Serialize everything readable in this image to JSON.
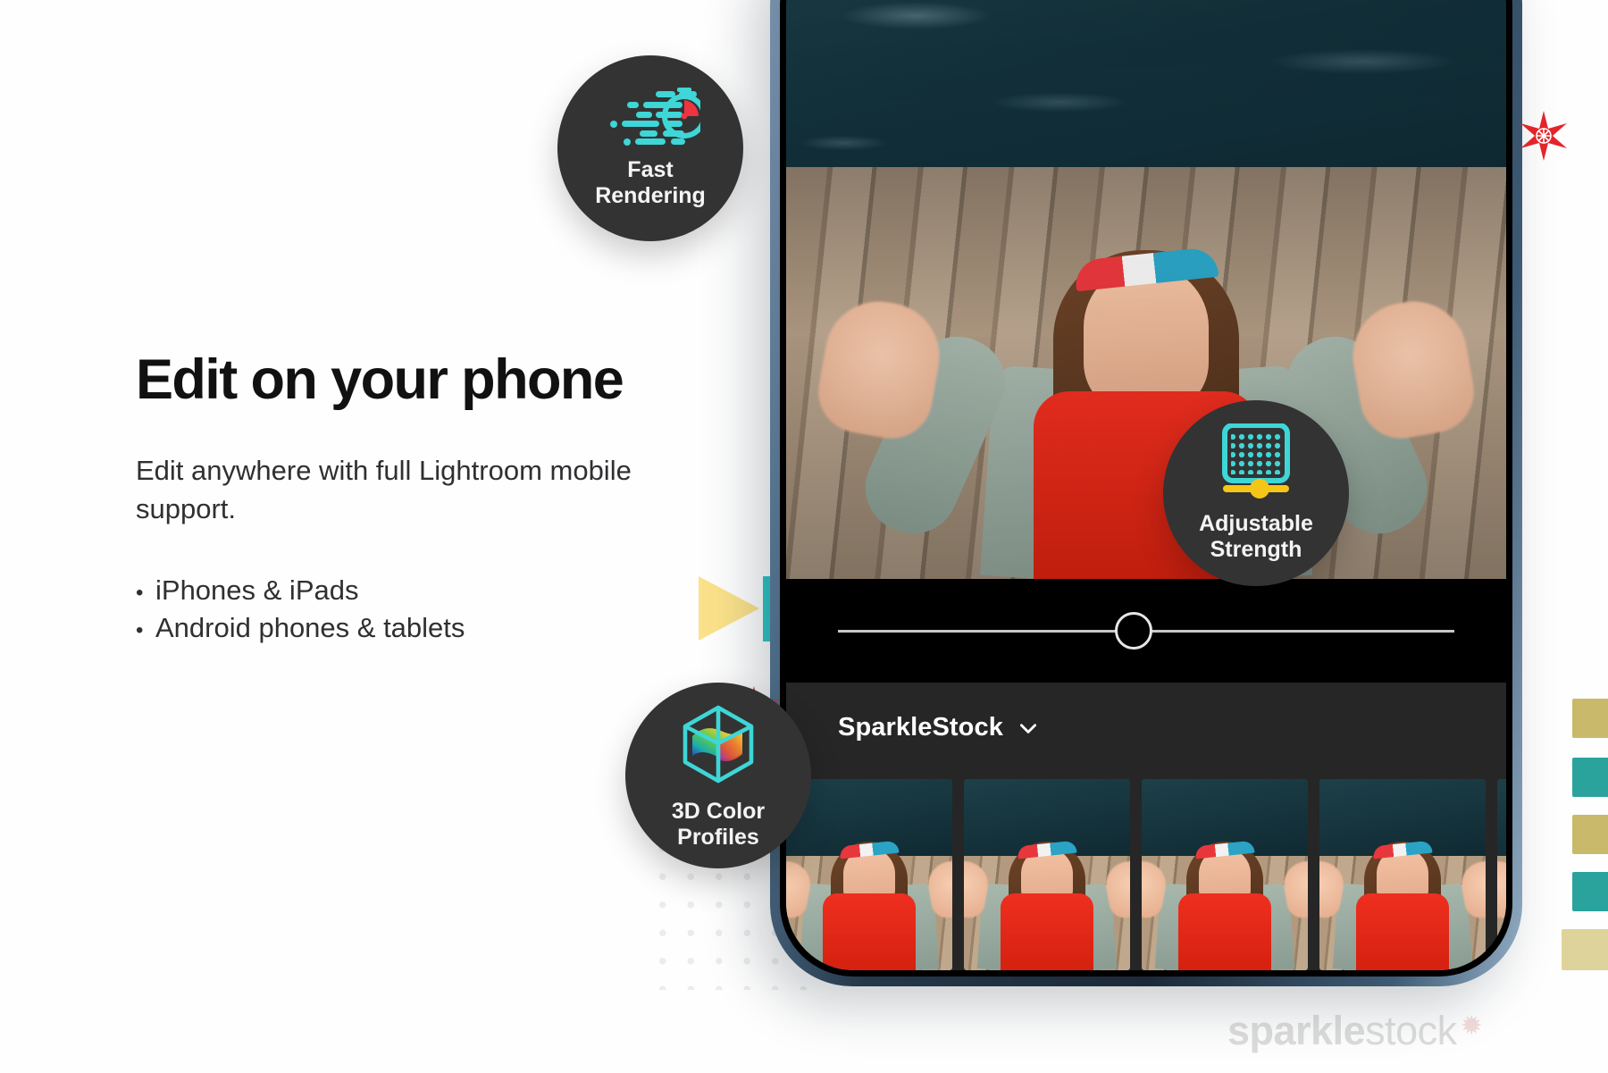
{
  "page": {
    "background_color": "#ffffff",
    "accent_teal": "#3ed6d6",
    "accent_yellow": "#fbe28a",
    "accent_red": "#e3252b",
    "badge_bg": "#333334"
  },
  "copy": {
    "headline": "Edit on your phone",
    "subcopy": "Edit anywhere with full Lightroom mobile support.",
    "bullet_marker": "•",
    "bullets": [
      "iPhones & iPads",
      "Android phones & tablets"
    ]
  },
  "badges": [
    {
      "id": "fast-rendering",
      "icon": "stopwatch-speed-icon",
      "line1": "Fast",
      "line2": "Rendering",
      "icon_colors": {
        "primary": "#3ed6d6",
        "secondary": "#ef3340"
      }
    },
    {
      "id": "adjustable-strength",
      "icon": "dotted-grid-slider-icon",
      "line1": "Adjustable",
      "line2": "Strength",
      "icon_colors": {
        "primary": "#3ed6d6",
        "secondary": "#f5c518"
      }
    },
    {
      "id": "3d-color-profiles",
      "icon": "color-cube-icon",
      "line1": "3D Color",
      "line2": "Profiles",
      "icon_colors": {
        "primary": "#3ed6d6",
        "secondary": "rainbow"
      }
    }
  ],
  "phone": {
    "app": {
      "slider": {
        "name": "strength-slider",
        "value_percent": 44
      },
      "preset_group": {
        "label": "SparkleStock",
        "chevron": "chevron-down-icon"
      },
      "thumbnails": [
        {
          "name": "preset-thumb-1"
        },
        {
          "name": "preset-thumb-2"
        },
        {
          "name": "preset-thumb-3"
        },
        {
          "name": "preset-thumb-4"
        },
        {
          "name": "preset-thumb-5"
        }
      ]
    }
  },
  "decor": {
    "stars": [
      {
        "name": "star-top-right"
      },
      {
        "name": "star-mid-left"
      }
    ],
    "triangle": {
      "name": "play-triangle",
      "color": "#fbe28a"
    },
    "teal_bar": {
      "name": "teal-accent-bar",
      "color": "#2ec4c4"
    },
    "dot_grid": {
      "name": "dot-grid-pattern",
      "color": "#ececec"
    },
    "edge_tabs": [
      {
        "color": "#c9b96a"
      },
      {
        "color": "#2aa39d"
      },
      {
        "color": "#c9b96a"
      },
      {
        "color": "#2aa39d"
      },
      {
        "color": "#ded39a"
      }
    ]
  },
  "watermark": {
    "bold": "sparkle",
    "light": "stock",
    "star": "✹"
  }
}
